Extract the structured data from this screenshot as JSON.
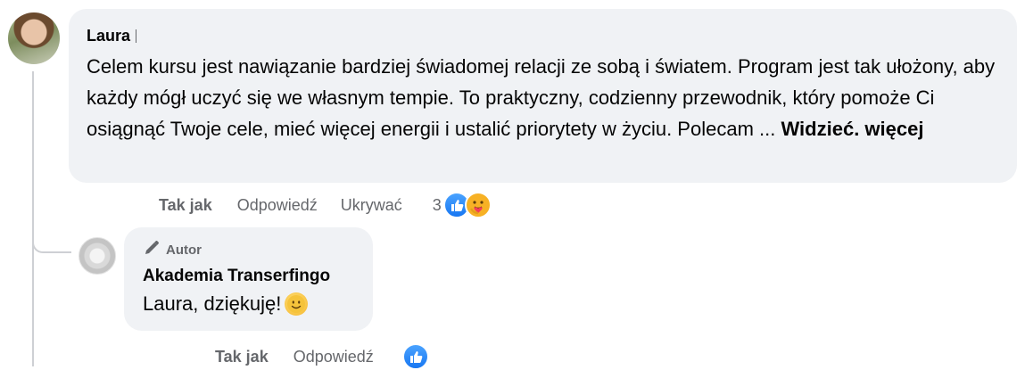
{
  "comment": {
    "author": "Laura",
    "text": "Celem kursu jest nawiązanie bardziej świadomej relacji ze sobą i światem. Program jest tak ułożony, aby każdy mógł uczyć się we własnym tempie. To praktyczny, codzienny przewodnik, który pomoże Ci osiągnąć Twoje cele, mieć więcej energii i ustalić priorytety w życiu. Polecam ...",
    "see_more": "Widzieć. więcej",
    "actions": {
      "like": "Tak jak",
      "reply": "Odpowiedź",
      "hide": "Ukrywać"
    },
    "reaction_count": "3",
    "reactions": [
      "like-icon",
      "care-icon"
    ]
  },
  "reply": {
    "badge": "Autor",
    "author": "Akademia Transerfingo",
    "text": "Laura, dziękuję!",
    "emoji": "smiling-face-icon",
    "actions": {
      "like": "Tak jak",
      "reply": "Odpowiedź"
    },
    "reactions": [
      "like-icon"
    ]
  },
  "colors": {
    "bubble": "#f0f2f5",
    "secondary_text": "#65676b",
    "like_blue": "#1877f2",
    "care_yellow": "#f7b125"
  }
}
